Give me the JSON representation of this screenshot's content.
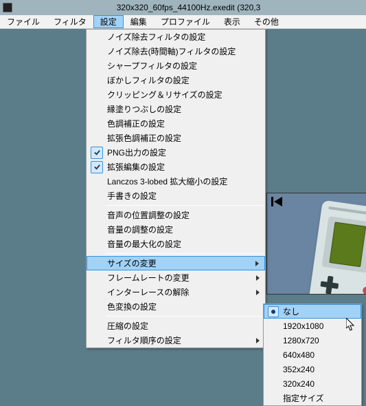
{
  "window": {
    "title": "320x320_60fps_44100Hz.exedit (320,3"
  },
  "menubar": {
    "items": [
      {
        "label": "ファイル"
      },
      {
        "label": "フィルタ"
      },
      {
        "label": "設定",
        "open": true
      },
      {
        "label": "編集"
      },
      {
        "label": "プロファイル"
      },
      {
        "label": "表示"
      },
      {
        "label": "その他"
      }
    ]
  },
  "dropdown": {
    "groups": [
      [
        {
          "label": "ノイズ除去フィルタの設定",
          "checked": false
        },
        {
          "label": "ノイズ除去(時間軸)フィルタの設定",
          "checked": false
        },
        {
          "label": "シャープフィルタの設定",
          "checked": false
        },
        {
          "label": "ぼかしフィルタの設定",
          "checked": false
        },
        {
          "label": "クリッピング＆リサイズの設定",
          "checked": false
        },
        {
          "label": "縁塗りつぶしの設定",
          "checked": false
        },
        {
          "label": "色調補正の設定",
          "checked": false
        },
        {
          "label": "拡張色調補正の設定",
          "checked": false
        },
        {
          "label": "PNG出力の設定",
          "checked": true
        },
        {
          "label": "拡張編集の設定",
          "checked": true
        },
        {
          "label": "Lanczos 3-lobed 拡大縮小の設定",
          "checked": false
        },
        {
          "label": "手書きの設定",
          "checked": false
        }
      ],
      [
        {
          "label": "音声の位置調整の設定",
          "checked": false
        },
        {
          "label": "音量の調整の設定",
          "checked": false
        },
        {
          "label": "音量の最大化の設定",
          "checked": false
        }
      ],
      [
        {
          "label": "サイズの変更",
          "submenu": true,
          "highlighted": true
        },
        {
          "label": "フレームレートの変更",
          "submenu": true
        },
        {
          "label": "インターレースの解除",
          "submenu": true
        },
        {
          "label": "色変換の設定",
          "submenu": false
        }
      ],
      [
        {
          "label": "圧縮の設定",
          "submenu": false
        },
        {
          "label": "フィルタ順序の設定",
          "submenu": true
        }
      ]
    ]
  },
  "submenu": {
    "items": [
      {
        "label": "なし",
        "selected": true,
        "highlighted": true
      },
      {
        "label": "1920x1080"
      },
      {
        "label": "1280x720"
      },
      {
        "label": "640x480"
      },
      {
        "label": "352x240"
      },
      {
        "label": "320x240"
      },
      {
        "label": "指定サイズ"
      }
    ]
  }
}
